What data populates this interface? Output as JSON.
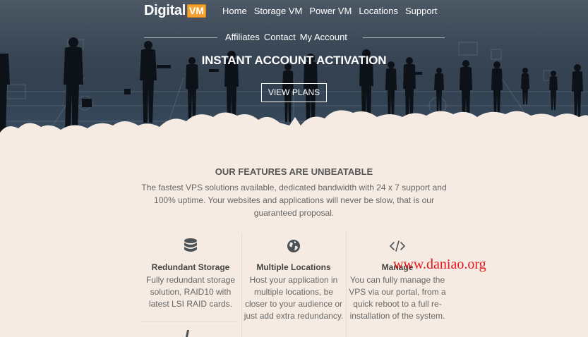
{
  "brand": {
    "name": "Digital",
    "badge": "VM"
  },
  "nav": {
    "row1": [
      "Home",
      "Storage VM",
      "Power VM",
      "Locations",
      "Support"
    ],
    "row2": [
      "Affiliates",
      "Contact",
      "My Account"
    ]
  },
  "hero": {
    "title": "INSTANT ACCOUNT ACTIVATION",
    "button": "VIEW PLANS"
  },
  "features": {
    "title": "OUR FEATURES ARE UNBEATABLE",
    "description": "The fastest VPS solutions available, dedicated bandwidth with 24 x 7 support and 100% uptime. Your websites and applications will never be slow, that is our guaranteed proposal.",
    "items": [
      {
        "icon": "database-icon",
        "title": "Redundant Storage",
        "text": "Fully redundant storage solution, RAID10 with latest LSI RAID cards."
      },
      {
        "icon": "globe-icon",
        "title": "Multiple Locations",
        "text": "Host your application in multiple locations, be closer to your audience or just add extra redundancy."
      },
      {
        "icon": "code-icon",
        "title": "Manage",
        "text": "You can fully manage the VPS via our portal, from a quick reboot to a full re-installation of the system."
      }
    ]
  },
  "watermark": "www.daniao.org",
  "colors": {
    "accent": "#f2a12e",
    "background": "#f6ebe3",
    "hero": "#34414f",
    "watermark": "#e4161b"
  }
}
